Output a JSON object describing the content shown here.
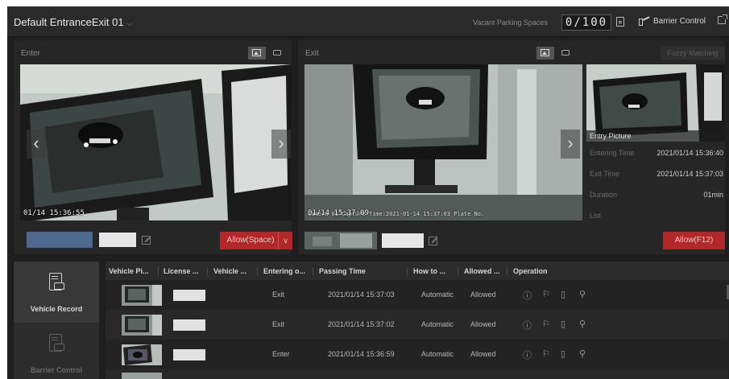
{
  "header": {
    "title": "Default EntranceExit 01",
    "vacant_label": "Vacant Parking Spaces",
    "vacant_count": "0/100",
    "barrier_label": "Barrier Control"
  },
  "enter": {
    "title": "Enter",
    "timestamp": "01/14 15:36:55",
    "allow_label": "Allow(Space)"
  },
  "exit": {
    "title": "Exit",
    "fuzzy_label": "Fuzzy Matching",
    "timestamp": "01/14 15:37:09",
    "overlay_text": "Camera 01 Capture Time:2021-01-14 15:37:03  Plate No.",
    "allow_label": "Allow(F12)"
  },
  "entry_info": {
    "picture_label": "Entry Picture",
    "rows": [
      {
        "label": "Entering Time",
        "value": "2021/01/14 15:36:40"
      },
      {
        "label": "Exit Time",
        "value": "2021/01/14 15:37:03"
      },
      {
        "label": "Duration",
        "value": "01min"
      },
      {
        "label": "List",
        "value": ""
      }
    ]
  },
  "nav": {
    "items": [
      {
        "label": "Vehicle Record"
      },
      {
        "label": "Barrier Control"
      }
    ]
  },
  "table": {
    "columns": [
      "Vehicle Pi...",
      "License ...",
      "Vehicle ...",
      "Entering o...",
      "Passing Time",
      "How to ...",
      "Allowed ...",
      "Operation"
    ],
    "rows": [
      {
        "direction": "Exit",
        "time": "2021/01/14 15:37:03",
        "how": "Automatic",
        "allowed": "Allowed"
      },
      {
        "direction": "Exit",
        "time": "2021/01/14 15:37:02",
        "how": "Automatic",
        "allowed": "Allowed"
      },
      {
        "direction": "Enter",
        "time": "2021/01/14 15:36:59",
        "how": "Automatic",
        "allowed": "Allowed"
      }
    ],
    "operation_icons": [
      "info-icon",
      "flag-icon",
      "document-icon",
      "search-icon"
    ]
  },
  "colors": {
    "background": "#1e1e1e",
    "panel": "#262626",
    "accent_red": "#b3262a",
    "plate_blue": "#4e6890"
  }
}
